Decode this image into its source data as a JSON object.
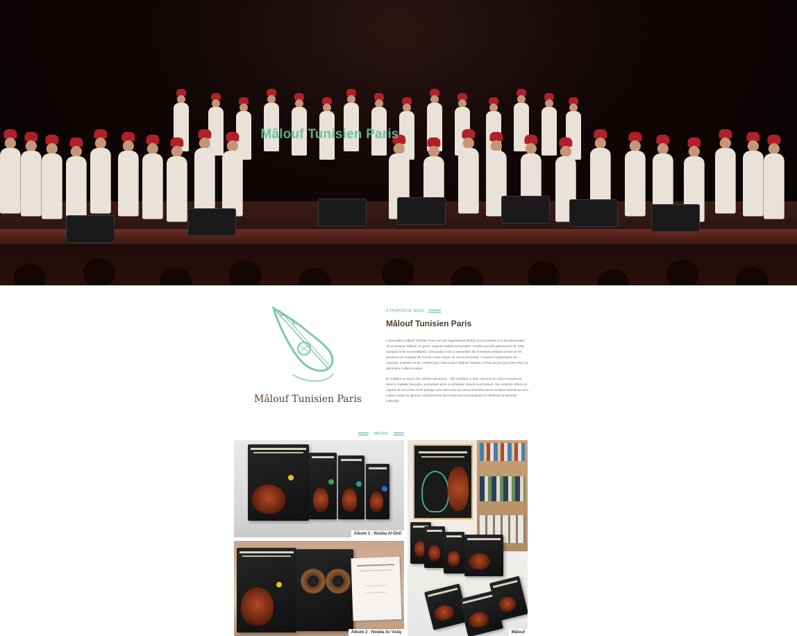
{
  "hero": {
    "title": "Mâlouf Tunisien Paris"
  },
  "about": {
    "logo_text": "Mâlouf Tunisien Paris",
    "eyebrow": "À PROPOS DE NOUS",
    "heading": "Mâlouf Tunisien Paris",
    "paragraph_1": "L'association Mâlouf Tunisien Paris est une organisation dédiée à la promotion et à la préservation de la musique Mâlouf, un genre musical traditionnel tunisien. Fondée par des passionnés de cette musique riche et envoûtante, l'association vise à rassembler les Tunisiens résidant à Paris et les amateurs de musique du monde entier autour de cet art ancestral. À travers l'organisation de concerts, d'ateliers et de conférences, l'association Mâlouf Tunisien à Paris œuvre pour faire vivre ce patrimoine culturel unique.",
    "paragraph_2": "En mettant en avant des artistes talentueux , elle contribue à faire rayonner la culture tunisienne dans la capitale française, permettant ainsi un échange culturel enrichissant. Ses activités offrent un espace de rencontre et de partage pour tous ceux qui sont intéressés par la musique tunisienne et la culture arabe en général, renforçant les liens entre les communautés et célébrant la diversité culturelle."
  },
  "gallery": {
    "eyebrow": "MÂLOUF",
    "items": [
      {
        "caption": "Album 1 : Noûba Al-Dhîl"
      },
      {
        "caption": "Album 2 : Noûba Al-'Arâq"
      },
      {
        "caption": "Mâlouf"
      }
    ]
  },
  "colors": {
    "accent": "#4aa98e",
    "heading": "#4a3a2e",
    "fez": "#b0202a"
  }
}
